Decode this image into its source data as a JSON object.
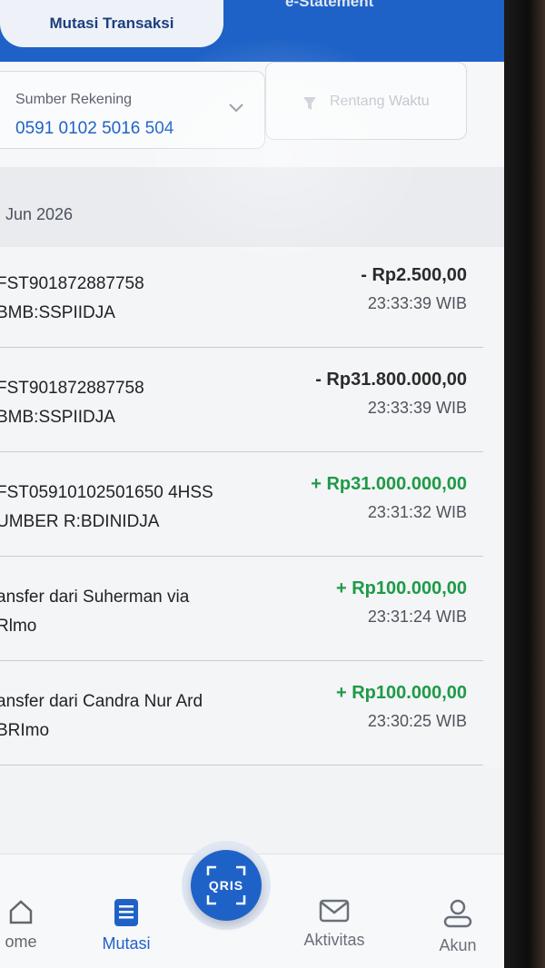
{
  "header": {
    "active_tab": "Mutasi Transaksi",
    "other_tab": "e-Statement"
  },
  "filter": {
    "account_label": "Sumber Rekening",
    "account_number": "0591 0102 5016 504",
    "date_range_label": "Rentang Waktu"
  },
  "month": "Jun 2026",
  "transactions": [
    {
      "line1": "FST901872887758",
      "line2": "BMB:SSPIIDJA",
      "amount": "- Rp2.500,00",
      "time": "23:33:39 WIB",
      "type": "debit"
    },
    {
      "line1": "FST901872887758",
      "line2": "BMB:SSPIIDJA",
      "amount": "- Rp31.800.000,00",
      "time": "23:33:39 WIB",
      "type": "debit"
    },
    {
      "line1": "FST05910102501650 4HSS",
      "line2": "UMBER R:BDINIDJA",
      "amount": "+ Rp31.000.000,00",
      "time": "23:31:32 WIB",
      "type": "credit"
    },
    {
      "line1": "ansfer dari Suherman via",
      "line2": "Rlmo",
      "amount": "+ Rp100.000,00",
      "time": "23:31:24 WIB",
      "type": "credit"
    },
    {
      "line1": "ansfer dari Candra Nur Ard",
      "line2": "BRImo",
      "amount": "+ Rp100.000,00",
      "time": "23:30:25 WIB",
      "type": "credit"
    }
  ],
  "nav": {
    "home": "ome",
    "mutasi": "Mutasi",
    "qris": "QRIS",
    "aktivitas": "Aktivitas",
    "akun": "Akun"
  },
  "colors": {
    "primary": "#1f62c7",
    "credit": "#1e9a47",
    "debit": "#2b2b2b"
  }
}
